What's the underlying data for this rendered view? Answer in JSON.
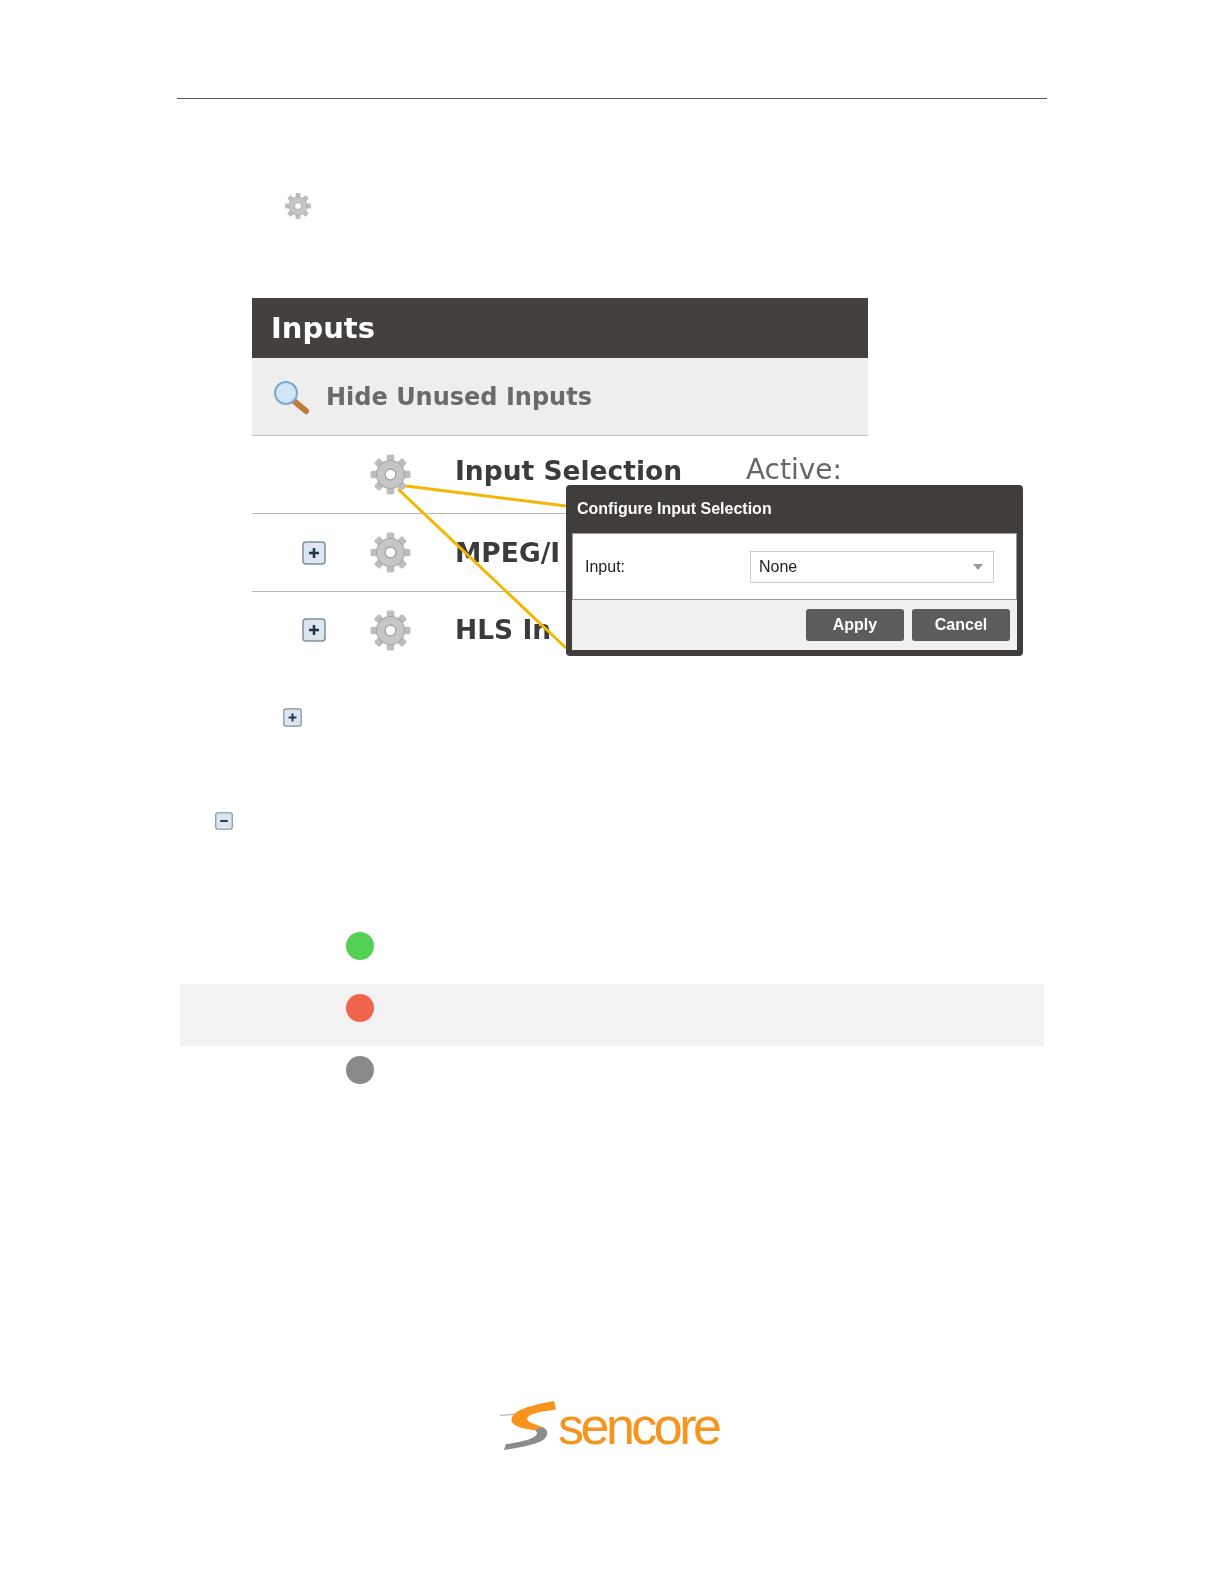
{
  "inputs_panel": {
    "title": "Inputs",
    "filter_link": "Hide Unused Inputs",
    "rows": [
      {
        "kind": "setting",
        "label": "Input Selection",
        "status_label": "Active:"
      },
      {
        "kind": "group",
        "label": "MPEG/I",
        "expanded": false
      },
      {
        "kind": "group",
        "label": "HLS In",
        "expanded": false
      }
    ],
    "dialog": {
      "title": "Configure Input Selection",
      "fields": [
        {
          "label": "Input:",
          "value": "None"
        }
      ],
      "buttons": [
        "Apply",
        "Cancel"
      ]
    }
  },
  "status_legend": [
    {
      "color": "#54d154",
      "shaded": false
    },
    {
      "color": "#f0644e",
      "shaded": true
    },
    {
      "color": "#8a8a8a",
      "shaded": false
    }
  ],
  "footer": {
    "logo_text": "sencore"
  }
}
